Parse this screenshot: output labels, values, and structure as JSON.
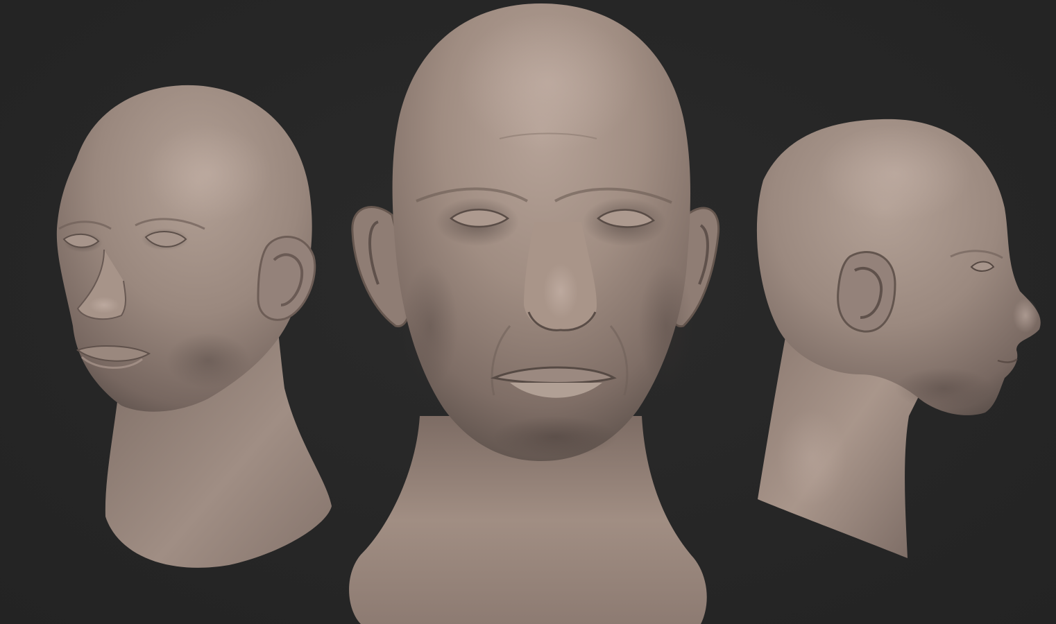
{
  "scene": {
    "background_color": "#262626",
    "material_color": "#a18f85",
    "views": [
      {
        "name": "three-quarter-left"
      },
      {
        "name": "front"
      },
      {
        "name": "side-right"
      }
    ]
  }
}
